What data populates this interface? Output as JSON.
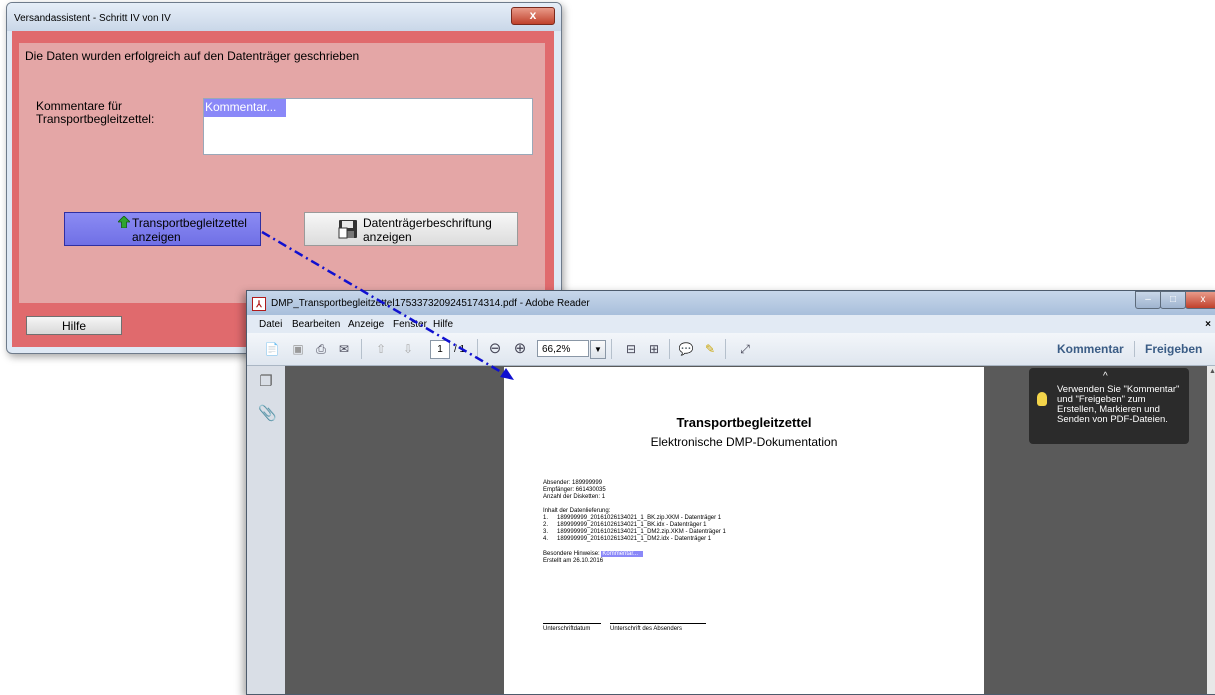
{
  "wizard": {
    "title": "Versandassistent - Schritt IV von IV",
    "close_label": "x",
    "message": "Die Daten wurden erfolgreich auf den Datenträger geschrieben",
    "comment_label_line1": "Kommentare für",
    "comment_label_line2": "Transportbegleitzettel:",
    "comment_value": "Kommentar...",
    "btn_transport_line1": "Transportbegleitzettel",
    "btn_transport_line2": "anzeigen",
    "btn_label_line1": "Datenträgerbeschriftung",
    "btn_label_line2": "anzeigen",
    "help_label": "Hilfe"
  },
  "reader": {
    "title": "DMP_Transportbegleitzettel1753373209245174314.pdf - Adobe Reader",
    "app_icon": "pdf-icon",
    "menu": [
      "Datei",
      "Bearbeiten",
      "Anzeige",
      "Fenster",
      "Hilfe"
    ],
    "menu_close": "×",
    "page_current": "1",
    "page_total": "/ 1",
    "zoom": "66,2%",
    "link_comment": "Kommentar",
    "link_share": "Freigeben",
    "toolbar_icons": [
      "create-pdf-icon",
      "save-icon",
      "print-icon",
      "email-icon",
      "page-up-icon",
      "page-down-icon",
      "zoom-out-icon",
      "zoom-in-icon",
      "fit-width-icon",
      "fit-page-icon",
      "comment-icon",
      "highlight-icon",
      "fullscreen-icon"
    ]
  },
  "pdf": {
    "title": "Transportbegleitzettel",
    "subtitle": "Elektronische DMP-Dokumentation",
    "sender": "Absender: 189999999",
    "receiver": "Empfänger: 661430035",
    "disk_count": "Anzahl der Disketten: 1",
    "contents_heading": "Inhalt der Datenlieferung:",
    "items": [
      {
        "num": "1.",
        "text": "189999999_20161026134021_1_BK.zip.XKM - Datenträger 1"
      },
      {
        "num": "2.",
        "text": "189999999_20161026134021_1_BK.idx - Datenträger 1"
      },
      {
        "num": "3.",
        "text": "189999999_20161026134021_1_DM2.zip.XKM - Datenträger 1"
      },
      {
        "num": "4.",
        "text": "189999999_20161026134021_1_DM2.idx - Datenträger 1"
      }
    ],
    "notes_label": "Besondere Hinweise:",
    "notes_value": "Kommentar...",
    "created": "Erstellt am 26.10.2016",
    "sig_date": "Unterschriftdatum",
    "sig_sender": "Unterschrift des Absenders"
  },
  "tooltip": {
    "caret": "^",
    "text": "Verwenden Sie \"Kommentar\"\nund \"Freigeben\" zum\nErstellen, Markieren und\nSenden von PDF-Dateien."
  },
  "colors": {
    "wizard_frame": "#e06a6d",
    "wizard_panel": "#e4a6a6",
    "selection": "#8a88f8",
    "arrow": "#1010d0"
  }
}
